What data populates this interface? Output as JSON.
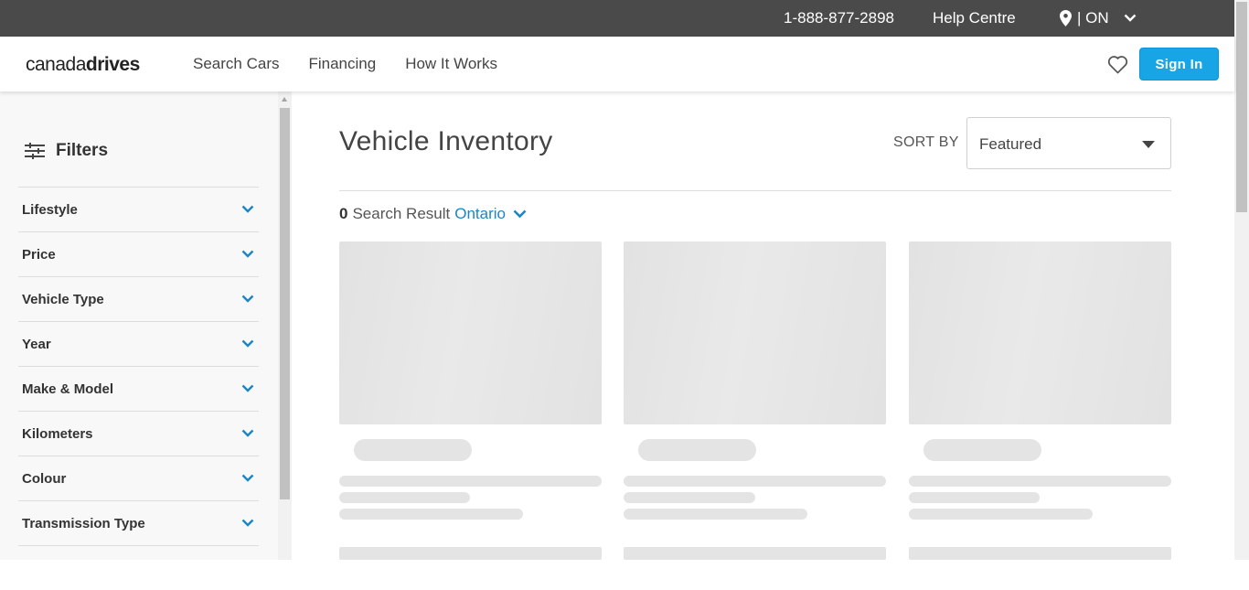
{
  "topbar": {
    "phone": "1-888-877-2898",
    "help": "Help Centre",
    "location": "| ON"
  },
  "nav": {
    "logo_light": "canada",
    "logo_bold": "drives",
    "links": [
      "Search Cars",
      "Financing",
      "How It Works"
    ],
    "sign_in": "Sign In"
  },
  "sidebar": {
    "title": "Filters",
    "filters": [
      "Lifestyle",
      "Price",
      "Vehicle Type",
      "Year",
      "Make & Model",
      "Kilometers",
      "Colour",
      "Transmission Type"
    ]
  },
  "main": {
    "title": "Vehicle Inventory",
    "sort_label": "SORT BY",
    "sort_value": "Featured",
    "result_count": "0",
    "result_text": "Search Result",
    "region": "Ontario"
  },
  "colors": {
    "accent": "#17a5e6",
    "link": "#1b86c2",
    "topbar": "#4a4a4a"
  }
}
